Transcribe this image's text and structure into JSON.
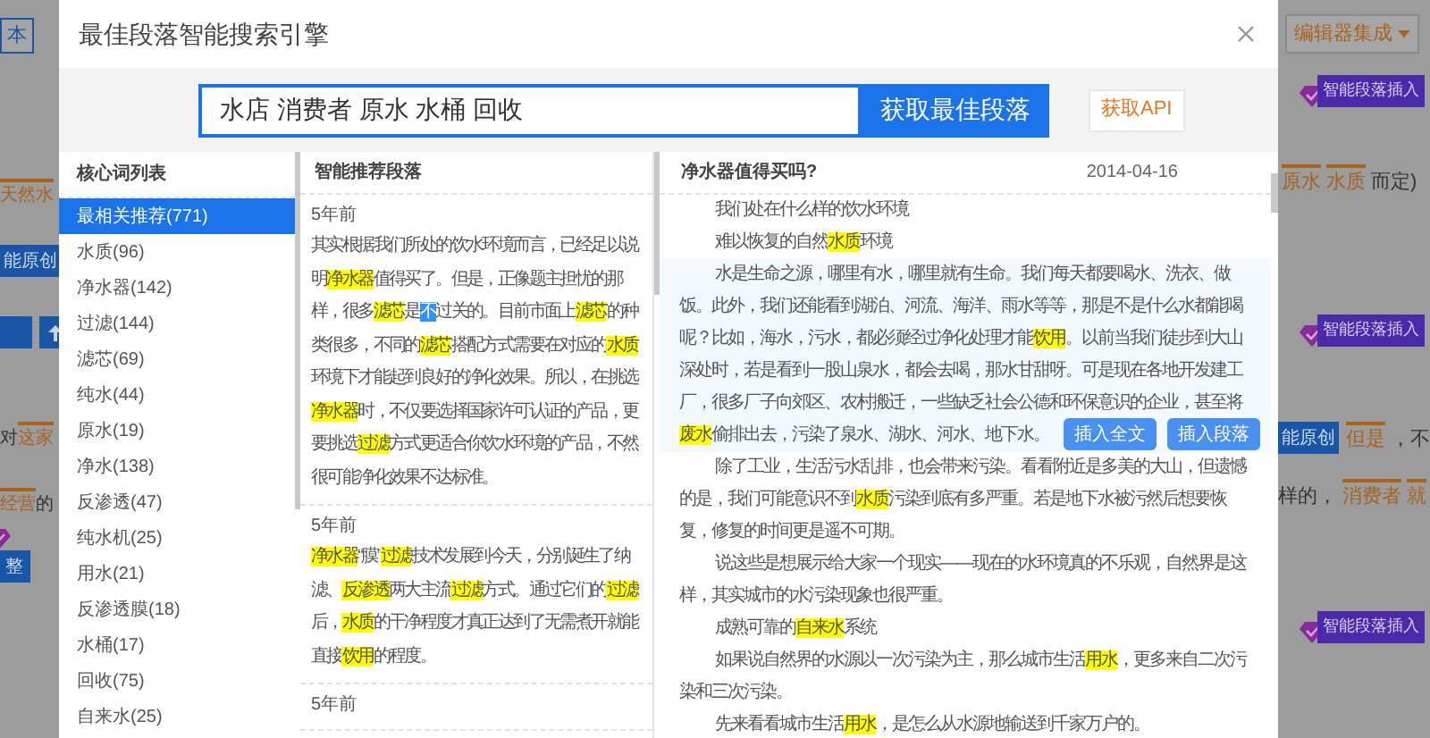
{
  "backdrop": {
    "left": [
      {
        "kind": "outline_button",
        "text": "本"
      },
      {
        "kind": "text",
        "segments": [
          {
            "text": "天然水",
            "keyword": true
          }
        ]
      },
      {
        "kind": "blue_button",
        "text": "能原创"
      },
      {
        "kind": "icon_buttons"
      },
      {
        "kind": "text",
        "segments": [
          {
            "text": "对",
            "keyword": false
          },
          {
            "text": "这家",
            "keyword": true
          }
        ]
      },
      {
        "kind": "text",
        "segments": [
          {
            "text": "经营",
            "keyword": true
          },
          {
            "text": "的",
            "keyword": false
          }
        ]
      },
      {
        "kind": "gem_button",
        "text": "整"
      }
    ],
    "right": [
      {
        "kind": "dropdown_button",
        "text": "编辑器集成"
      },
      {
        "kind": "gem_badge",
        "text": "智能段落插入"
      },
      {
        "kind": "text",
        "segments": [
          {
            "text": "原水",
            "keyword": true
          },
          {
            "text": "水质",
            "keyword": true
          },
          {
            "text": "而定)",
            "keyword": false
          }
        ]
      },
      {
        "kind": "gem_badge",
        "text": "智能段落插入"
      },
      {
        "kind": "button_text",
        "button": "能原创",
        "segments": [
          {
            "text": "但是",
            "keyword": true
          },
          {
            "text": "，不",
            "keyword": false
          }
        ]
      },
      {
        "kind": "text",
        "segments": [
          {
            "text": "样的，",
            "keyword": false
          },
          {
            "text": "消费者",
            "keyword": true
          },
          {
            "text": "就",
            "keyword": true
          }
        ]
      },
      {
        "kind": "gem_badge",
        "text": "智能段落插入"
      }
    ]
  },
  "dialog": {
    "title": "最佳段落智能搜索引擎",
    "search": {
      "value": "水店 消费者 原水 水桶 回收",
      "button": "获取最佳段落"
    },
    "api_button": "获取API"
  },
  "keywords": {
    "title": "核心词列表",
    "items": [
      {
        "label": "最相关推荐(771)",
        "selected": true
      },
      {
        "label": "水质(96)",
        "selected": false
      },
      {
        "label": "净水器(142)",
        "selected": false
      },
      {
        "label": "过滤(144)",
        "selected": false
      },
      {
        "label": "滤芯(69)",
        "selected": false
      },
      {
        "label": "纯水(44)",
        "selected": false
      },
      {
        "label": "原水(19)",
        "selected": false
      },
      {
        "label": "净水(138)",
        "selected": false
      },
      {
        "label": "反渗透(47)",
        "selected": false
      },
      {
        "label": "纯水机(25)",
        "selected": false
      },
      {
        "label": "用水(21)",
        "selected": false
      },
      {
        "label": "反渗透膜(18)",
        "selected": false
      },
      {
        "label": "水桶(17)",
        "selected": false
      },
      {
        "label": "回收(75)",
        "selected": false
      },
      {
        "label": "自来水(25)",
        "selected": false
      }
    ]
  },
  "recommended": {
    "title": "智能推荐段落",
    "items": [
      {
        "date": "5年前",
        "segments": [
          {
            "text": "其实根据我们所处的饮水环境而言，已经足以说明",
            "kind": "plain"
          },
          {
            "text": "净水器",
            "kind": "keyword"
          },
          {
            "text": "值得买了。但是，正像题主担忧的那样，很多",
            "kind": "plain"
          },
          {
            "text": "滤芯",
            "kind": "keyword"
          },
          {
            "text": "是",
            "kind": "plain"
          },
          {
            "text": "不",
            "kind": "selection"
          },
          {
            "text": "过关的。目前市面上",
            "kind": "plain"
          },
          {
            "text": "滤芯",
            "kind": "keyword"
          },
          {
            "text": "的种类很多，不同的",
            "kind": "plain"
          },
          {
            "text": "滤芯",
            "kind": "keyword"
          },
          {
            "text": "搭配方式需要在对应的",
            "kind": "plain"
          },
          {
            "text": "水质",
            "kind": "keyword"
          },
          {
            "text": "环境下才能起到良好的净化效果。所以，在挑选",
            "kind": "plain"
          },
          {
            "text": "净水器",
            "kind": "keyword"
          },
          {
            "text": "时，不仅要选择国家许可认证的产品，更要挑选",
            "kind": "plain"
          },
          {
            "text": "过滤",
            "kind": "keyword"
          },
          {
            "text": "方式更适合你饮水环境的产品，不然很可能净化效果不达标准。",
            "kind": "plain"
          }
        ]
      },
      {
        "date": "5年前",
        "segments": [
          {
            "text": "净水器",
            "kind": "keyword"
          },
          {
            "text": "“膜”",
            "kind": "plain"
          },
          {
            "text": "过滤",
            "kind": "keyword"
          },
          {
            "text": "技术发展到今天，分别诞生了纳滤、",
            "kind": "plain"
          },
          {
            "text": "反渗透",
            "kind": "keyword"
          },
          {
            "text": "两大主流",
            "kind": "plain"
          },
          {
            "text": "过滤",
            "kind": "keyword"
          },
          {
            "text": "方式。通过它们的",
            "kind": "plain"
          },
          {
            "text": "过滤",
            "kind": "keyword"
          },
          {
            "text": "后，",
            "kind": "plain"
          },
          {
            "text": "水质",
            "kind": "keyword"
          },
          {
            "text": "的干净程度才真正达到了无需煮开就能直接",
            "kind": "plain"
          },
          {
            "text": "饮用",
            "kind": "keyword"
          },
          {
            "text": "的程度。",
            "kind": "plain"
          }
        ]
      },
      {
        "date": "5年前"
      }
    ]
  },
  "article": {
    "title": "净水器值得买吗?",
    "date": "2014-04-16",
    "buttons": [
      "插入全文",
      "插入段落"
    ],
    "paragraphs": [
      {
        "selected": false,
        "segments": [
          {
            "text": "我们处在什么样的饮水环境",
            "keyword": false
          }
        ]
      },
      {
        "selected": false,
        "segments": [
          {
            "text": "难以恢复的自然",
            "keyword": false
          },
          {
            "text": "水质",
            "keyword": true
          },
          {
            "text": "环境",
            "keyword": false
          }
        ]
      },
      {
        "selected": true,
        "segments": [
          {
            "text": "水是生命之源，哪里有水，哪里就有生命。我们每天都要喝水、洗衣、做饭。此外，我们还能看到湖泊、河流、海洋、雨水等等，那是不是什么水都能喝呢？比如，海水，污水，都必须经过净化处理才能",
            "keyword": false
          },
          {
            "text": "饮用",
            "keyword": true
          },
          {
            "text": "。以前当我们徒步到大山深处时，若是看到一股山泉水，都会去喝，那水甘甜呀。可是现在各地开发建工厂，很多厂子向郊区、农村搬迁，一些缺乏社会公德和环保意识的企业，甚至将",
            "keyword": false
          },
          {
            "text": "废水",
            "keyword": true
          },
          {
            "text": "偷排出去，污染了泉水、湖水、河水、地下水。",
            "keyword": false
          }
        ]
      },
      {
        "selected": false,
        "segments": [
          {
            "text": "除了工业，生活污水乱排，也会带来污染。看看附近是多美的大山，但遗憾的是，我们可能意识不到",
            "keyword": false
          },
          {
            "text": "水质",
            "keyword": true
          },
          {
            "text": "污染到底有多严重。若是地下水被污然后想要恢复，修复的时间更是遥不可期。",
            "keyword": false
          }
        ]
      },
      {
        "selected": false,
        "segments": [
          {
            "text": "说这些是想展示给大家一个现实——现在的水环境真的不乐观，自然界是这样，其实城市的水污染现象也很严重。",
            "keyword": false
          }
        ]
      },
      {
        "selected": false,
        "segments": [
          {
            "text": "成熟可靠的",
            "keyword": false
          },
          {
            "text": "自来水",
            "keyword": true
          },
          {
            "text": "系统",
            "keyword": false
          }
        ]
      },
      {
        "selected": false,
        "segments": [
          {
            "text": "如果说自然界的水源以一次污染为主，那么城市生活",
            "keyword": false
          },
          {
            "text": "用水",
            "keyword": true
          },
          {
            "text": "，更多来自二次污染和三次污染。",
            "keyword": false
          }
        ]
      },
      {
        "selected": false,
        "segments": [
          {
            "text": "先来看看城市生活",
            "keyword": false
          },
          {
            "text": "用水",
            "keyword": true
          },
          {
            "text": "，是怎么从水源地输送到千家万户的。",
            "keyword": false
          }
        ]
      }
    ]
  }
}
